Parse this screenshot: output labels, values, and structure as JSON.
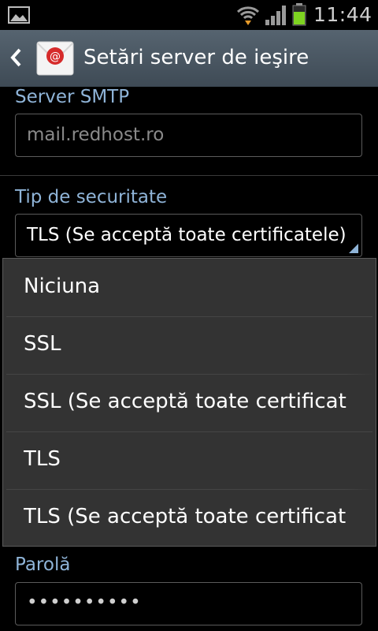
{
  "status_bar": {
    "time": "11:44",
    "icons": [
      "gallery-icon",
      "wifi-icon",
      "signal-icon",
      "battery-icon"
    ],
    "battery_color": "#7ed321"
  },
  "action_bar": {
    "title": "Setări server de ieşire",
    "app_icon": "email-icon"
  },
  "form": {
    "smtp_label": "Server SMTP",
    "smtp_value": "mail.redhost.ro",
    "security_label": "Tip de securitate",
    "security_value": "TLS (Se acceptă toate certificatele)",
    "password_label": "Parolă",
    "password_value": "••••••••••"
  },
  "dropdown": {
    "options": [
      "Niciuna",
      "SSL",
      "SSL (Se acceptă toate certificat",
      "TLS",
      "TLS (Se acceptă toate certificat"
    ]
  },
  "colors": {
    "accent": "#8fb4d8",
    "action_bar": "#4a5662",
    "popup": "#333333"
  }
}
